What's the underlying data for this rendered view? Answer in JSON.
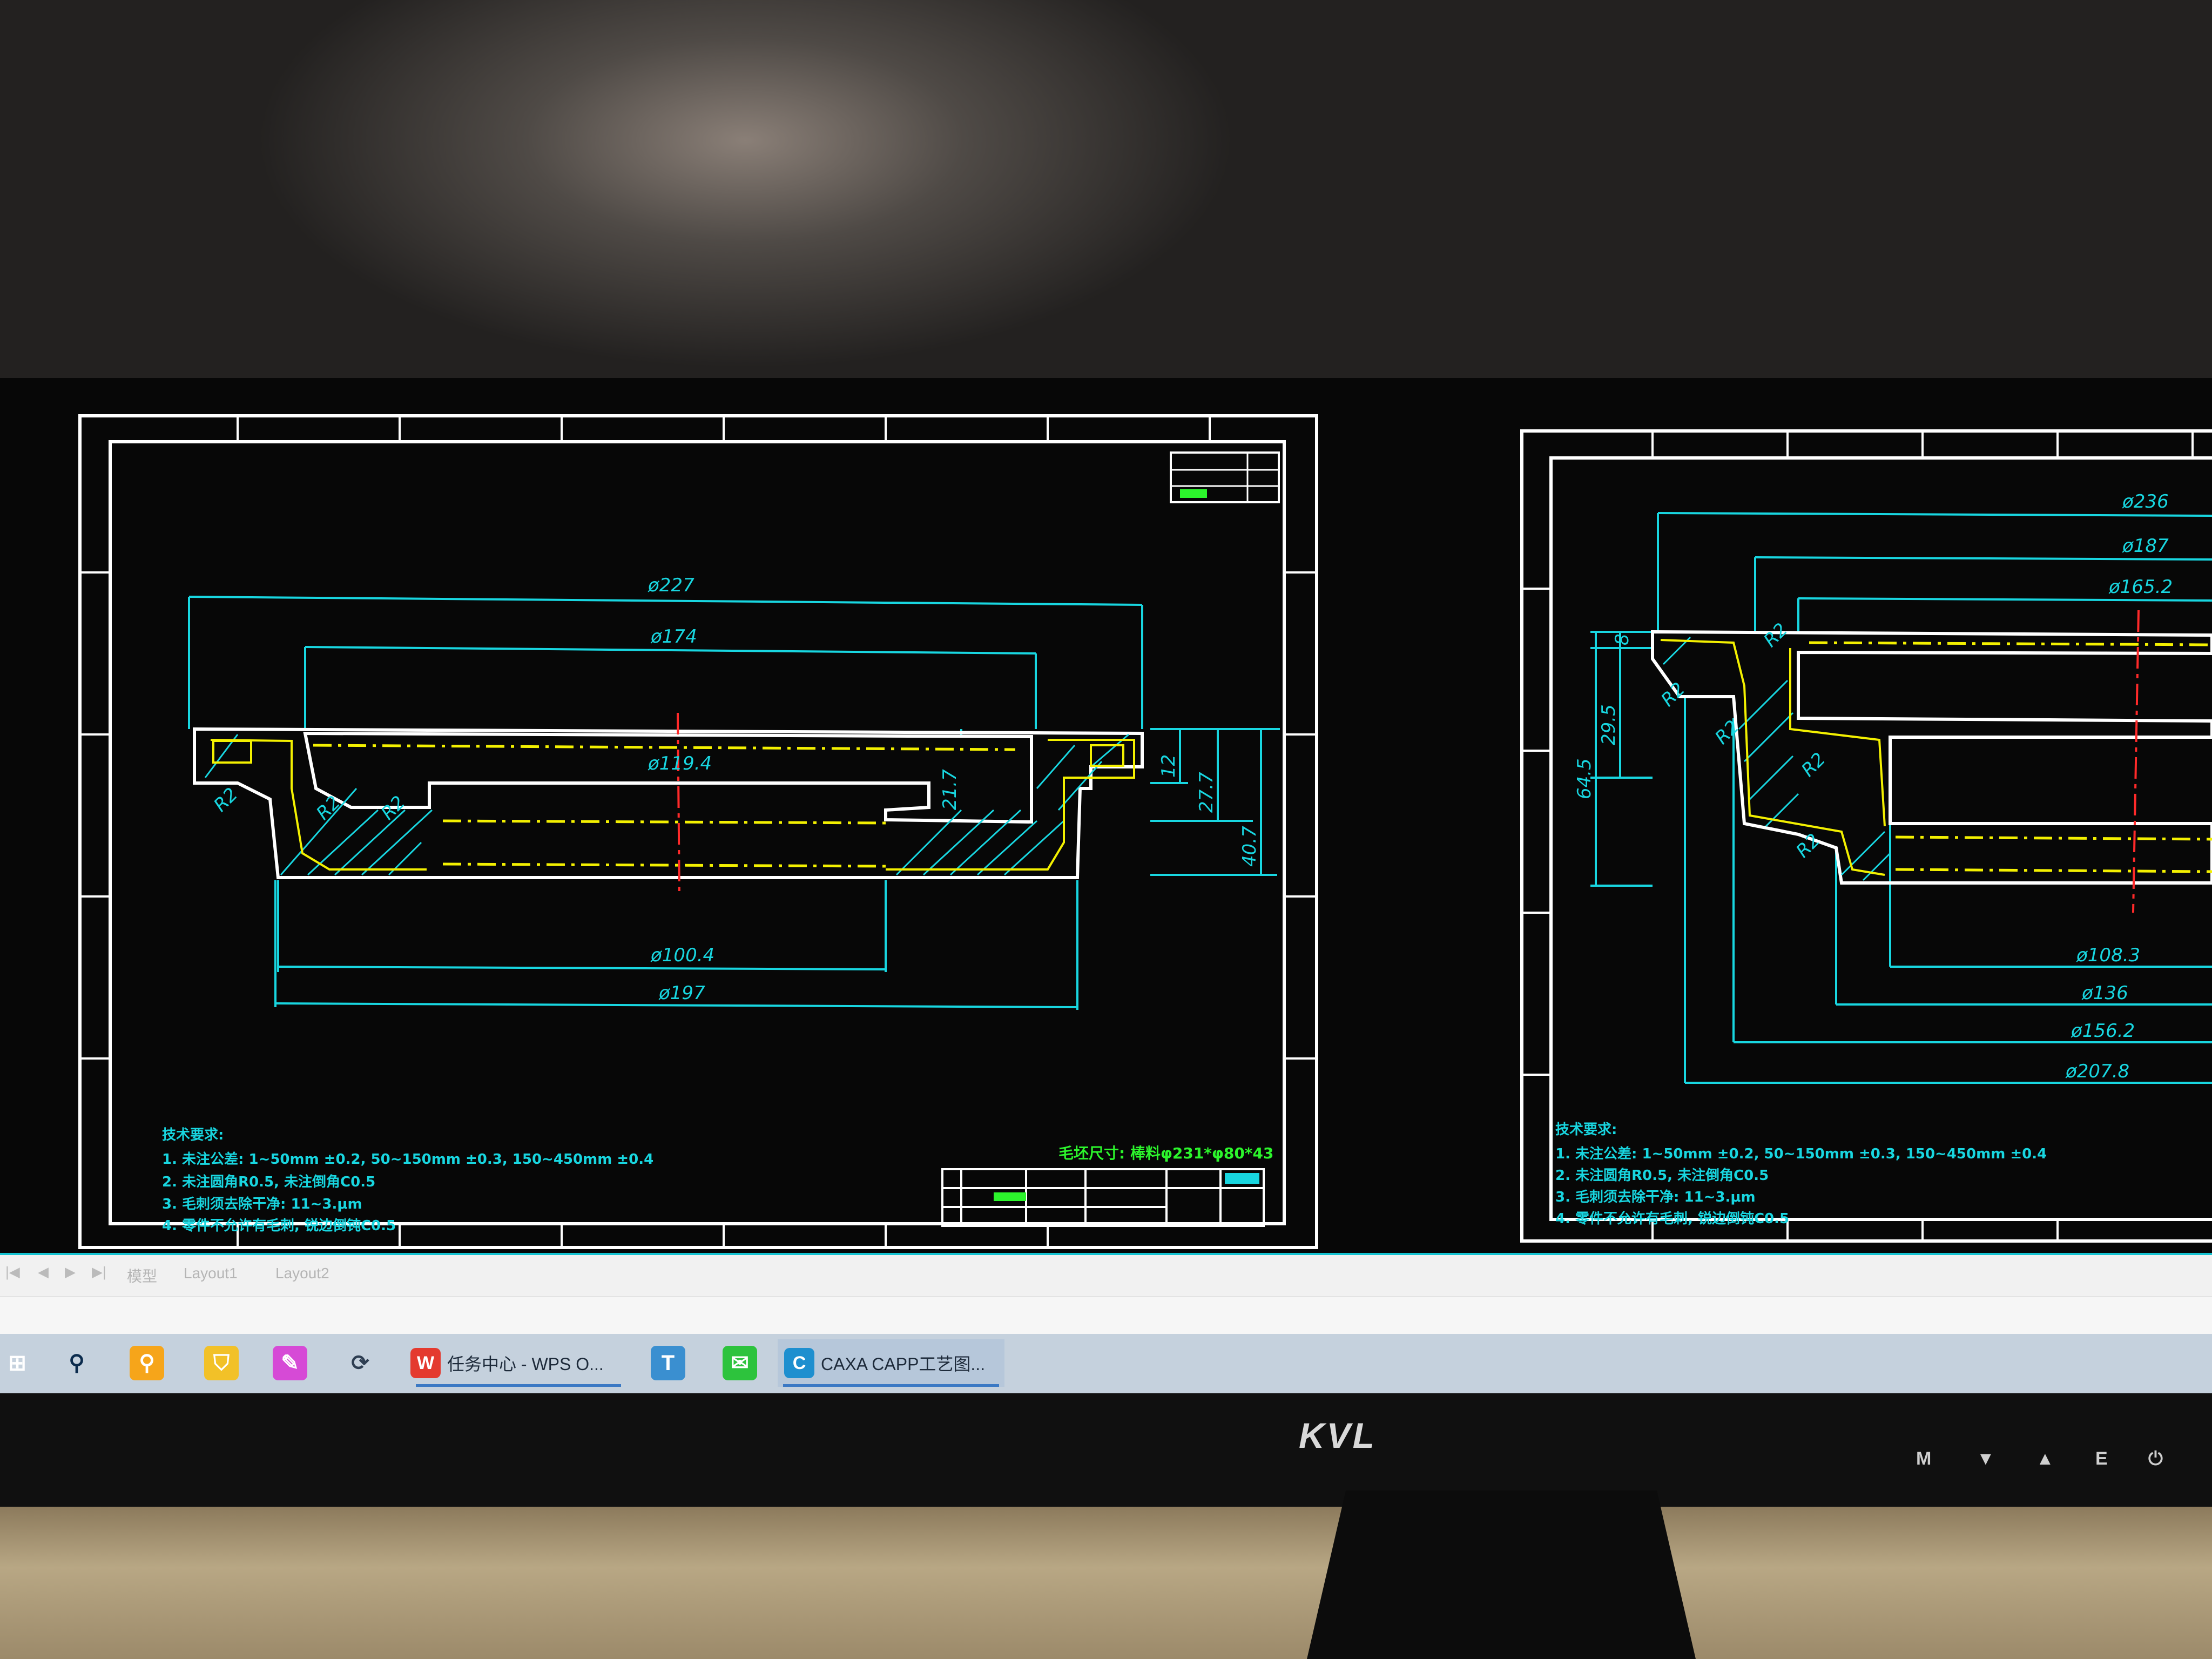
{
  "drawing_left": {
    "dimensions": {
      "d227": "ø227",
      "d174": "ø174",
      "d119": "ø119.4",
      "d100": "ø100.4",
      "d197": "ø197",
      "v217": "21.7",
      "v12": "12",
      "v277": "27.7",
      "v407": "40.7",
      "r1": "R2",
      "r2": "R2",
      "r3": "R2"
    },
    "notes_title": "技术要求:",
    "notes": [
      "1. 未注公差: 1~50mm ±0.2, 50~150mm ±0.3, 150~450mm ±0.4",
      "2. 未注圆角R0.5, 未注倒角C0.5",
      "3. 毛刺须去除干净: 11~3.μm",
      "4. 零件不允许有毛刺, 锐边倒钝C0.5"
    ],
    "blank_size": "毛坯尺寸: 棒料φ231*φ80*43"
  },
  "drawing_right": {
    "dimensions": {
      "d236": "ø236",
      "d187": "ø187",
      "d165": "ø165.2",
      "d108": "ø108.3",
      "d136": "ø136",
      "d156": "ø156.2",
      "d207": "ø207.8",
      "v8": "8",
      "v295": "29.5",
      "v645": "64.5",
      "r1": "R2",
      "r2": "R2",
      "r3": "R2",
      "r4": "R2",
      "r5": "R2"
    },
    "notes_title": "技术要求:",
    "notes": [
      "1. 未注公差: 1~50mm ±0.2, 50~150mm ±0.3, 150~450mm ±0.4",
      "2. 未注圆角R0.5, 未注倒角C0.5",
      "3. 毛刺须去除干净: 11~3.μm",
      "4. 零件不允许有毛刺, 锐边倒钝C0.5"
    ]
  },
  "layout_tabs": [
    "模型",
    "Layout1",
    "Layout2"
  ],
  "taskbar": {
    "wps_label": "任务中心 - WPS O...",
    "caxa_label": "CAXA CAPP工艺图...",
    "wps_icon": "wps-icon",
    "caxa_icon": "caxa-icon"
  },
  "monitor": {
    "brand": "KVL",
    "buttons": [
      "M",
      "▼",
      "▲",
      "E",
      "⏻"
    ]
  },
  "colors": {
    "dimension": "#18d6e0",
    "outline": "#ffffff",
    "centerline": "#ff2a2a",
    "hidden": "#f3f000",
    "notes_highlight": "#2cf52c"
  }
}
